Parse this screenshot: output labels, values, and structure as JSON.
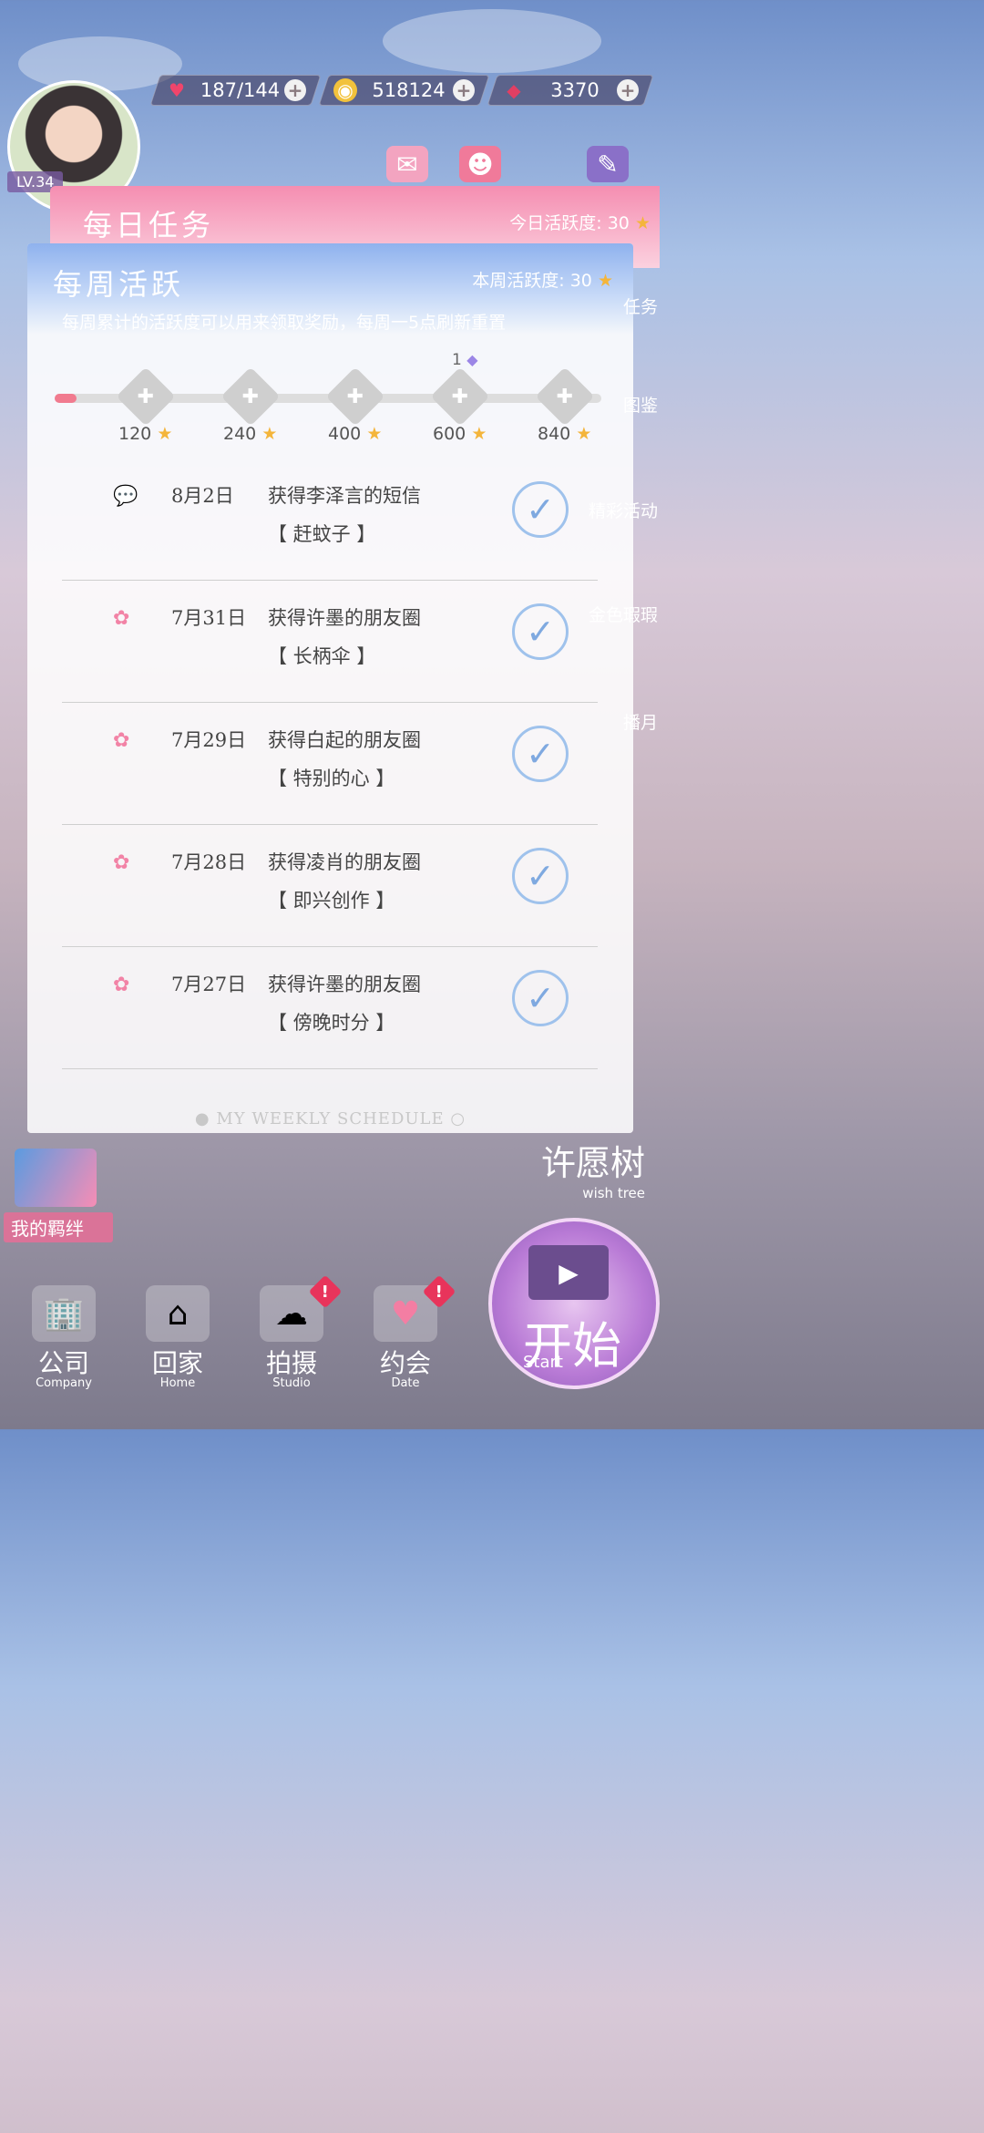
{
  "top_bar": {
    "stamina": "187/144",
    "coins": "518124",
    "diamonds": "3370"
  },
  "player": {
    "level": "LV.34"
  },
  "daily": {
    "title": "每日任务",
    "score_label": "今日活跃度: 30"
  },
  "weekly": {
    "title": "每周活跃",
    "score_label": "本周活跃度: 30",
    "description": "每周累计的活跃度可以用来领取奖励，每周一5点刷新重置",
    "reward_count": "1",
    "progress_fraction": 0.04,
    "milestones": [
      {
        "value": "120"
      },
      {
        "value": "240"
      },
      {
        "value": "400"
      },
      {
        "value": "600"
      },
      {
        "value": "840"
      }
    ],
    "log": [
      {
        "icon": "message-bubble-icon",
        "date": "8月2日",
        "text": "获得李泽言的短信",
        "sub": "【 赶蚊子 】"
      },
      {
        "icon": "sakura-icon",
        "date": "7月31日",
        "text": "获得许墨的朋友圈",
        "sub": "【 长柄伞 】"
      },
      {
        "icon": "sakura-icon",
        "date": "7月29日",
        "text": "获得白起的朋友圈",
        "sub": "【 特别的心 】"
      },
      {
        "icon": "sakura-icon",
        "date": "7月28日",
        "text": "获得凌肖的朋友圈",
        "sub": "【 即兴创作 】"
      },
      {
        "icon": "sakura-icon",
        "date": "7月27日",
        "text": "获得许墨的朋友圈",
        "sub": "【 傍晚时分 】"
      }
    ],
    "footer": "● MY WEEKLY SCHEDULE ○"
  },
  "side_right": [
    "任务",
    "图鉴",
    "精彩活动",
    "金色瑕瑕",
    "播月"
  ],
  "bond": {
    "label": "我的羁绊"
  },
  "wish_tree": {
    "cn": "许愿树",
    "en": "wish tree"
  },
  "nav": [
    {
      "cn": "公司",
      "en": "Company",
      "alert": false
    },
    {
      "cn": "回家",
      "en": "Home",
      "alert": false
    },
    {
      "cn": "拍摄",
      "en": "Studio",
      "alert": true
    },
    {
      "cn": "约会",
      "en": "Date",
      "alert": true
    }
  ],
  "start": {
    "cn": "开始",
    "en": "Start"
  },
  "colors": {
    "accent_pink": "#f58eb1",
    "weekly_blue": "#8fb2ee",
    "check_blue": "#9fc2ec"
  }
}
